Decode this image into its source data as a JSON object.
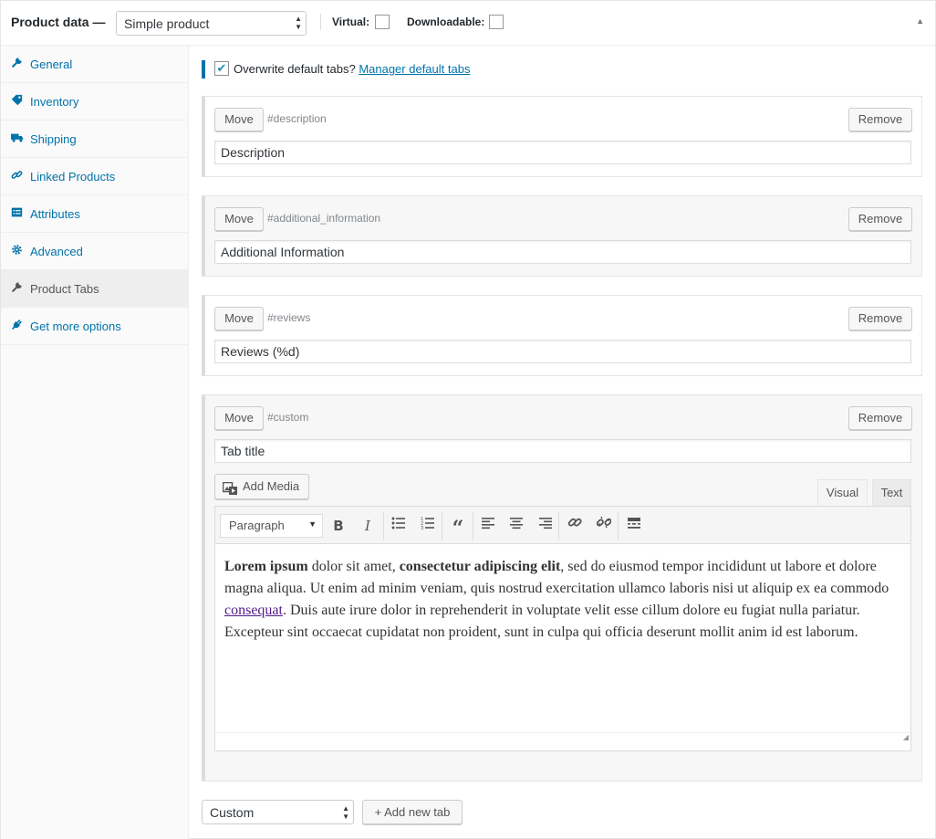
{
  "header": {
    "title": "Product data —",
    "product_type": "Simple product",
    "virtual_label": "Virtual:",
    "downloadable_label": "Downloadable:",
    "collapse_icon": "triangle-up-icon"
  },
  "sidebar": {
    "items": [
      {
        "label": "General",
        "icon": "wrench-icon"
      },
      {
        "label": "Inventory",
        "icon": "tag-icon"
      },
      {
        "label": "Shipping",
        "icon": "truck-icon"
      },
      {
        "label": "Linked Products",
        "icon": "link-icon"
      },
      {
        "label": "Attributes",
        "icon": "list-icon"
      },
      {
        "label": "Advanced",
        "icon": "gear-icon"
      },
      {
        "label": "Product Tabs",
        "icon": "wrench-icon",
        "active": true
      },
      {
        "label": "Get more options",
        "icon": "plug-icon"
      }
    ]
  },
  "override": {
    "checked": true,
    "label": "Overwrite default tabs?",
    "link": "Manager default tabs"
  },
  "tabs": [
    {
      "move": "Move",
      "slug": "#description",
      "remove": "Remove",
      "title": "Description"
    },
    {
      "move": "Move",
      "slug": "#additional_information",
      "remove": "Remove",
      "title": "Additional Information"
    },
    {
      "move": "Move",
      "slug": "#reviews",
      "remove": "Remove",
      "title": "Reviews (%d)"
    },
    {
      "move": "Move",
      "slug": "#custom",
      "remove": "Remove",
      "title": "Tab title"
    }
  ],
  "editor": {
    "add_media": "Add Media",
    "visual_tab": "Visual",
    "text_tab": "Text",
    "format": "Paragraph",
    "content": {
      "bold1": "Lorem ipsum",
      "t1": " dolor sit amet, ",
      "bold2": "consectetur adipiscing elit",
      "t2": ", sed do eiusmod tempor incididunt ut labore et dolore magna aliqua. Ut enim ad minim veniam, quis nostrud exercitation ullamco laboris nisi ut aliquip ex ea commodo ",
      "link": "consequat",
      "t3": ". Duis aute irure dolor in reprehenderit in voluptate velit esse cillum dolore eu fugiat nulla pariatur. Excepteur sint occaecat cupidatat non proident, sunt in culpa qui officia deserunt mollit anim id est laborum."
    }
  },
  "footer": {
    "tab_type": "Custom",
    "add_button": "+ Add new tab"
  }
}
